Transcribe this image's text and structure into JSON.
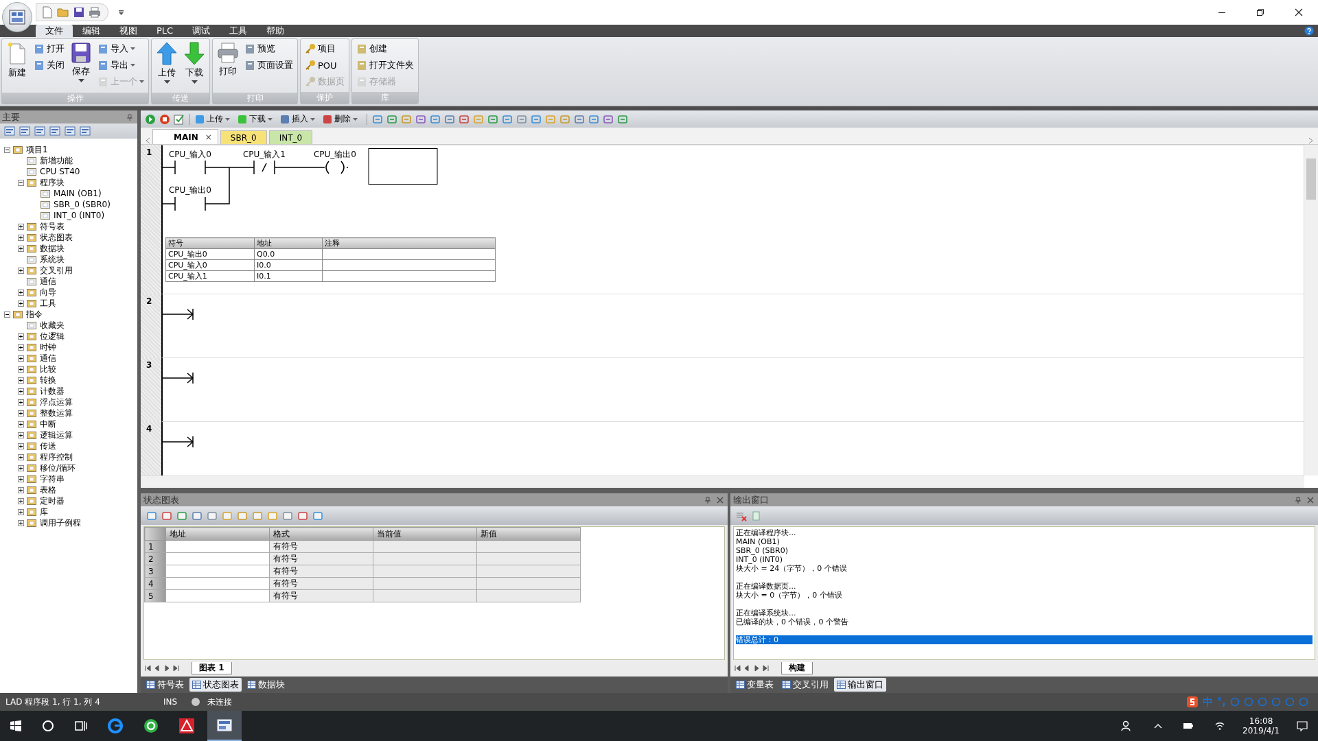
{
  "menu_tabs": [
    {
      "label": "文件",
      "selected": true
    },
    {
      "label": "编辑",
      "selected": false
    },
    {
      "label": "视图",
      "selected": false
    },
    {
      "label": "PLC",
      "selected": false
    },
    {
      "label": "调试",
      "selected": false
    },
    {
      "label": "工具",
      "selected": false
    },
    {
      "label": "帮助",
      "selected": false
    }
  ],
  "ribbon_groups": [
    {
      "label": "操作",
      "columns": [
        {
          "kind": "large",
          "items": [
            {
              "label": "新建",
              "dropdown": false,
              "disabled": false
            }
          ]
        },
        {
          "kind": "small",
          "items": [
            {
              "label": "打开",
              "dropdown": false,
              "disabled": false
            },
            {
              "label": "关闭",
              "dropdown": false,
              "disabled": false
            }
          ]
        },
        {
          "kind": "large",
          "items": [
            {
              "label": "保存",
              "dropdown": true,
              "disabled": false
            }
          ]
        },
        {
          "kind": "small",
          "items": [
            {
              "label": "导入",
              "dropdown": true,
              "disabled": false
            },
            {
              "label": "导出",
              "dropdown": true,
              "disabled": false
            },
            {
              "label": "上一个",
              "dropdown": true,
              "disabled": true
            }
          ]
        }
      ]
    },
    {
      "label": "传送",
      "columns": [
        {
          "kind": "upload",
          "items": [
            {
              "label": "上传",
              "dropdown": true,
              "disabled": false
            }
          ]
        },
        {
          "kind": "download",
          "items": [
            {
              "label": "下载",
              "dropdown": true,
              "disabled": false
            }
          ]
        }
      ]
    },
    {
      "label": "打印",
      "columns": [
        {
          "kind": "large",
          "items": [
            {
              "label": "打印",
              "dropdown": false,
              "disabled": false
            }
          ]
        },
        {
          "kind": "small",
          "items": [
            {
              "label": "预览",
              "dropdown": false,
              "disabled": false
            },
            {
              "label": "页面设置",
              "dropdown": false,
              "disabled": false
            }
          ]
        }
      ]
    },
    {
      "label": "保护",
      "columns": [
        {
          "kind": "small",
          "items": [
            {
              "label": "项目",
              "dropdown": false,
              "disabled": false
            },
            {
              "label": "POU",
              "dropdown": false,
              "disabled": false
            },
            {
              "label": "数据页",
              "dropdown": false,
              "disabled": true
            }
          ]
        }
      ]
    },
    {
      "label": "库",
      "columns": [
        {
          "kind": "small",
          "items": [
            {
              "label": "创建",
              "dropdown": false,
              "disabled": false
            },
            {
              "label": "打开文件夹",
              "dropdown": false,
              "disabled": false
            },
            {
              "label": "存储器",
              "dropdown": false,
              "disabled": true
            }
          ]
        }
      ]
    }
  ],
  "project_panel": {
    "title": "主要",
    "tree": [
      {
        "label": "项目1",
        "expanded": true,
        "children": [
          {
            "label": "新增功能"
          },
          {
            "label": "CPU ST40"
          },
          {
            "label": "程序块",
            "expanded": true,
            "children": [
              {
                "label": "MAIN (OB1)"
              },
              {
                "label": "SBR_0 (SBR0)"
              },
              {
                "label": "INT_0 (INT0)"
              }
            ]
          },
          {
            "label": "符号表",
            "expanded": false
          },
          {
            "label": "状态图表",
            "expanded": false
          },
          {
            "label": "数据块",
            "expanded": false
          },
          {
            "label": "系统块"
          },
          {
            "label": "交叉引用",
            "expanded": false
          },
          {
            "label": "通信"
          },
          {
            "label": "向导",
            "expanded": false
          },
          {
            "label": "工具",
            "expanded": false
          }
        ]
      },
      {
        "label": "指令",
        "expanded": true,
        "children": [
          {
            "label": "收藏夹"
          },
          {
            "label": "位逻辑",
            "expanded": false
          },
          {
            "label": "时钟",
            "expanded": false
          },
          {
            "label": "通信",
            "expanded": false
          },
          {
            "label": "比较",
            "expanded": false
          },
          {
            "label": "转换",
            "expanded": false
          },
          {
            "label": "计数器",
            "expanded": false
          },
          {
            "label": "浮点运算",
            "expanded": false
          },
          {
            "label": "整数运算",
            "expanded": false
          },
          {
            "label": "中断",
            "expanded": false
          },
          {
            "label": "逻辑运算",
            "expanded": false
          },
          {
            "label": "传送",
            "expanded": false
          },
          {
            "label": "程序控制",
            "expanded": false
          },
          {
            "label": "移位/循环",
            "expanded": false
          },
          {
            "label": "字符串",
            "expanded": false
          },
          {
            "label": "表格",
            "expanded": false
          },
          {
            "label": "定时器",
            "expanded": false
          },
          {
            "label": "库",
            "expanded": false
          },
          {
            "label": "调用子例程",
            "expanded": false
          }
        ]
      }
    ]
  },
  "editor_toolbar": [
    {
      "label": "上传"
    },
    {
      "label": "下载"
    },
    {
      "label": "插入"
    },
    {
      "label": "删除"
    }
  ],
  "editor_tabs": [
    {
      "label": "MAIN",
      "selected": true,
      "color": "#ffffff",
      "close": "×"
    },
    {
      "label": "SBR_0",
      "selected": false,
      "color": "#f7e27a"
    },
    {
      "label": "INT_0",
      "selected": false,
      "color": "#c9e6a8"
    }
  ],
  "networks": [
    {
      "number": "1",
      "kind": "logic",
      "elements": [
        {
          "kind": "normally_open",
          "label": "CPU_输入0"
        },
        {
          "kind": "normally_closed",
          "label": "CPU_输入1"
        },
        {
          "kind": "coil",
          "label": "CPU_输出0"
        }
      ],
      "branch": [
        {
          "kind": "normally_open",
          "label": "CPU_输出0"
        }
      ],
      "symbol_table": {
        "columns": [
          "符号",
          "地址",
          "注释"
        ],
        "rows": [
          [
            "CPU_输出0",
            "Q0.0"
          ],
          [
            "CPU_输入0",
            "I0.0"
          ],
          [
            "CPU_输入1",
            "I0.1"
          ]
        ]
      }
    },
    {
      "number": "2",
      "kind": "empty"
    },
    {
      "number": "3",
      "kind": "empty"
    },
    {
      "number": "4",
      "kind": "empty"
    }
  ],
  "status_chart": {
    "title": "状态图表",
    "columns": [
      "地址",
      "格式",
      "当前值",
      "新值"
    ],
    "rows": [
      {
        "number": "1",
        "format": "有符号"
      },
      {
        "number": "2",
        "format": "有符号"
      },
      {
        "number": "3",
        "format": "有符号"
      },
      {
        "number": "4",
        "format": "有符号"
      },
      {
        "number": "5",
        "format": "有符号"
      }
    ],
    "sheet_tab": "图表 1"
  },
  "left_bottom_tabs": [
    {
      "label": "符号表",
      "selected": false
    },
    {
      "label": "状态图表",
      "selected": true
    },
    {
      "label": "数据块",
      "selected": false
    }
  ],
  "output_window": {
    "title": "输出窗口",
    "blocks": [
      [
        {
          "text": "正在编译程序块...",
          "selected": false
        },
        {
          "text": "MAIN (OB1)",
          "selected": false
        },
        {
          "text": "SBR_0 (SBR0)",
          "selected": false
        },
        {
          "text": "INT_0 (INT0)",
          "selected": false
        },
        {
          "text": "块大小 = 24（字节），0 个错误",
          "selected": false
        }
      ],
      [
        {
          "text": "正在编译数据页...",
          "selected": false
        },
        {
          "text": "块大小 = 0（字节），0 个错误",
          "selected": false
        }
      ],
      [
        {
          "text": "正在编译系统块...",
          "selected": false
        },
        {
          "text": "已编译的块，0 个错误，0 个警告",
          "selected": false
        }
      ],
      [
        {
          "text": "错误总计：0",
          "selected": true
        }
      ]
    ],
    "sheet_tab": "构建"
  },
  "right_bottom_tabs": [
    {
      "label": "变量表",
      "selected": false
    },
    {
      "label": "交叉引用",
      "selected": false
    },
    {
      "label": "输出窗口",
      "selected": true
    }
  ],
  "status_bar": {
    "position": "LAD 程序段 1, 行 1, 列 4",
    "mode": "INS",
    "connection": "未连接"
  },
  "ime_bar": [
    "中",
    "°,"
  ],
  "clock": {
    "time": "16:08",
    "date": "2019/4/1"
  }
}
